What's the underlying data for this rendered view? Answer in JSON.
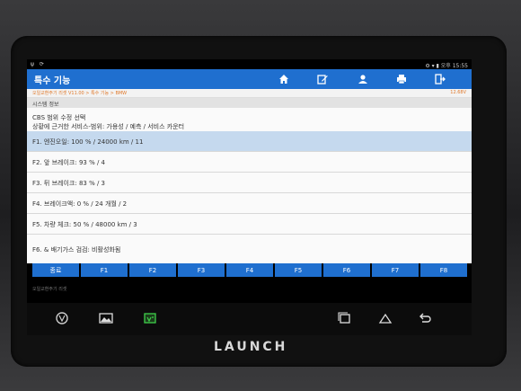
{
  "statusbar": {
    "left": "ψ ⟳",
    "right": "⚙ ▾ ▮ 오후 15:55"
  },
  "app": {
    "title": "특수 기능"
  },
  "toolbar": {
    "icons": [
      "home-icon",
      "edit-icon",
      "user-icon",
      "print-icon",
      "exit-icon"
    ]
  },
  "crumb": {
    "path": "오일교환주기 리셋 V11.00 > 특수 기능 > BMW",
    "battery": "12.68V"
  },
  "section": {
    "title": "시스템 정보"
  },
  "desc": {
    "line1": "CBS 범위 수정 선택",
    "line2": "상황에 근거한 서비스-범위: 가용성 / 예측 / 서비스 카운터"
  },
  "rows": [
    {
      "label": "F1.  엔진오일: 100 % /  24000 km / 11"
    },
    {
      "label": "F2.  앞 브레이크: 93 % / 4"
    },
    {
      "label": "F3.  뒤 브레이크: 83 % / 3"
    },
    {
      "label": "F4.  브레이크액: 0 % / 24 개월 / 2"
    },
    {
      "label": "F5.  차량 체크: 50 % / 48000 km / 3"
    },
    {
      "label": "F6. & 배기가스 검검: 비활성화됨"
    }
  ],
  "fkeys": [
    "종료",
    "F1",
    "F2",
    "F3",
    "F4",
    "F5",
    "F6",
    "F7",
    "F8"
  ],
  "footer": {
    "text": "오일교환주기 리셋"
  },
  "device": {
    "brand": "LAUNCH"
  },
  "colors": {
    "accent": "#1f6fcf",
    "selected_row": "#c5d9ee",
    "crumb": "#e07a2d"
  }
}
